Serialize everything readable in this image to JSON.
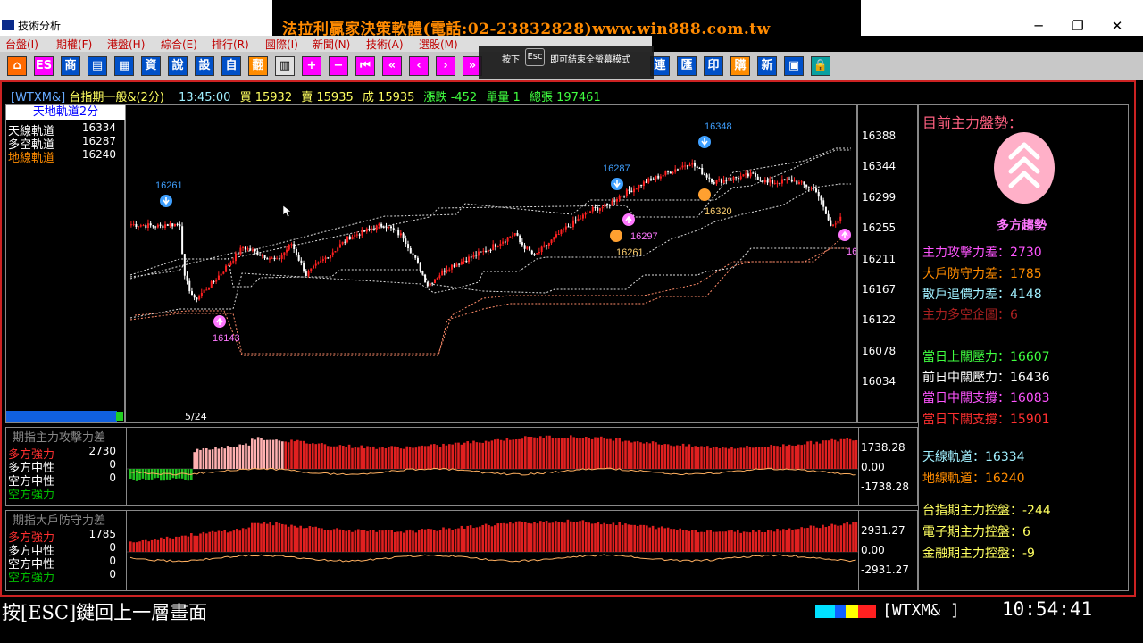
{
  "window": {
    "title": "技術分析",
    "banner": "法拉利贏家決策軟體(電話:02-23832828)www.win888.com.tw",
    "controls": {
      "minimize": "─",
      "restore": "❐",
      "close": "✕"
    }
  },
  "menu": [
    {
      "label": "台盤(I)"
    },
    {
      "label": "期權(F)"
    },
    {
      "label": "港盤(H)"
    },
    {
      "label": "綜合(E)"
    },
    {
      "label": "排行(R)"
    },
    {
      "label": "國際(I)"
    },
    {
      "label": "新聞(N)"
    },
    {
      "label": "技術(A)"
    },
    {
      "label": "選股(M)"
    }
  ],
  "toolbar": {
    "buttons": [
      {
        "name": "home-icon",
        "glyph": "⌂",
        "bg": "#ff6a00",
        "fg": "#fff"
      },
      {
        "name": "esc-icon",
        "glyph": "ES",
        "bg": "#ff00ff",
        "fg": "#fff"
      },
      {
        "name": "commodity-button",
        "glyph": "商",
        "bg": "#0050c8",
        "fg": "#fff"
      },
      {
        "name": "chart-button",
        "glyph": "▤",
        "bg": "#0050c8",
        "fg": "#fff"
      },
      {
        "name": "chart2-button",
        "glyph": "▦",
        "bg": "#0050c8",
        "fg": "#fff"
      },
      {
        "name": "info-button",
        "glyph": "資",
        "bg": "#0050c8",
        "fg": "#fff"
      },
      {
        "name": "said-button",
        "glyph": "說",
        "bg": "#0050c8",
        "fg": "#fff"
      },
      {
        "name": "set-button",
        "glyph": "設",
        "bg": "#0050c8",
        "fg": "#fff"
      },
      {
        "name": "self-button",
        "glyph": "自",
        "bg": "#0050c8",
        "fg": "#fff"
      },
      {
        "name": "report-button",
        "glyph": "翻",
        "bg": "#ff8c00",
        "fg": "#fff"
      },
      {
        "name": "list-button",
        "glyph": "▥",
        "bg": "#e0e0e0",
        "fg": "#000"
      },
      {
        "name": "plus-icon",
        "glyph": "+",
        "bg": "#ff00ff",
        "fg": "#fff"
      },
      {
        "name": "minus-icon",
        "glyph": "−",
        "bg": "#ff00ff",
        "fg": "#fff"
      },
      {
        "name": "first-icon",
        "glyph": "⏮",
        "bg": "#ff00ff",
        "fg": "#fff"
      },
      {
        "name": "fast-back-icon",
        "glyph": "«",
        "bg": "#ff00ff",
        "fg": "#fff"
      },
      {
        "name": "back-icon",
        "glyph": "‹",
        "bg": "#ff00ff",
        "fg": "#fff"
      },
      {
        "name": "forward-icon",
        "glyph": "›",
        "bg": "#ff00ff",
        "fg": "#fff"
      },
      {
        "name": "fast-forward-icon",
        "glyph": "»",
        "bg": "#ff00ff",
        "fg": "#fff"
      },
      {
        "name": "link-button",
        "glyph": "連",
        "bg": "#0050c8",
        "fg": "#fff"
      },
      {
        "name": "exchange-button",
        "glyph": "匯",
        "bg": "#0050c8",
        "fg": "#fff"
      },
      {
        "name": "print-button",
        "glyph": "印",
        "bg": "#0050c8",
        "fg": "#fff"
      },
      {
        "name": "buy-button",
        "glyph": "購",
        "bg": "#ff8c00",
        "fg": "#fff"
      },
      {
        "name": "new-button",
        "glyph": "新",
        "bg": "#0050c8",
        "fg": "#fff"
      },
      {
        "name": "window-icon",
        "glyph": "▣",
        "bg": "#0050c8",
        "fg": "#fff"
      },
      {
        "name": "lock-icon",
        "glyph": "🔒",
        "bg": "#0aa0a0",
        "fg": "#fff"
      }
    ],
    "esc_tip": {
      "prefix": "按下",
      "key": "Esc",
      "suffix": "即可結束全螢幕模式"
    }
  },
  "info_line": {
    "symbol": "[WTXM&]",
    "name": "台指期一般&(2分)",
    "time": "13:45:00",
    "bid_label": "買",
    "bid": "15932",
    "ask_label": "賣",
    "ask": "15935",
    "deal_label": "成",
    "deal": "15935",
    "change_label": "漲跌",
    "change": "-452",
    "vol_label": "單量",
    "vol": "1",
    "total_label": "總張",
    "total": "197461"
  },
  "main_legend": {
    "title": "天地軌道2分",
    "rows": [
      {
        "label": "天線軌道",
        "value": "16334",
        "color": "#ffffff"
      },
      {
        "label": "多空軌道",
        "value": "16287",
        "color": "#ffffff"
      },
      {
        "label": "地線軌道",
        "value": "16240",
        "color": "#ff8c00"
      }
    ],
    "date": "5/24"
  },
  "main_axis": [
    "16388",
    "16344",
    "16299",
    "16255",
    "16211",
    "16167",
    "16122",
    "16078",
    "16034"
  ],
  "markers": [
    {
      "label": "16261",
      "color": "#3fa0ff"
    },
    {
      "label": "16143",
      "color": "#ff77ff"
    },
    {
      "label": "16287",
      "color": "#3fa0ff"
    },
    {
      "label": "16297",
      "color": "#ff77ff"
    },
    {
      "label": "16261",
      "color": "#ffa030"
    },
    {
      "label": "16348",
      "color": "#3fa0ff"
    },
    {
      "label": "16320",
      "color": "#ffa030"
    },
    {
      "label": "16",
      "color": "#ff77ff"
    }
  ],
  "sub1": {
    "title": "期指主力攻擊力差",
    "rows": [
      {
        "label": "多方強力",
        "value": "2730",
        "color": "#ff3030"
      },
      {
        "label": "多方中性",
        "value": "0",
        "color": "#ffffff"
      },
      {
        "label": "空方中性",
        "value": "0",
        "color": "#ffffff"
      },
      {
        "label": "空方強力",
        "value": "",
        "color": "#00c000"
      }
    ],
    "axis": [
      "1738.28",
      "0.00",
      "-1738.28"
    ]
  },
  "sub2": {
    "title": "期指大戶防守力差",
    "rows": [
      {
        "label": "多方強力",
        "value": "1785",
        "color": "#ff3030"
      },
      {
        "label": "多方中性",
        "value": "0",
        "color": "#ffffff"
      },
      {
        "label": "空方中性",
        "value": "0",
        "color": "#ffffff"
      },
      {
        "label": "空方強力",
        "value": "0",
        "color": "#00c000"
      }
    ],
    "axis": [
      "2931.27",
      "0.00",
      "-2931.27"
    ]
  },
  "side": {
    "header": "目前主力盤勢：",
    "trend": "多方趨勢",
    "rows": [
      {
        "text": "主力攻擊力差：2730",
        "color": "#ff55ff"
      },
      {
        "text": "大戶防守力差：1785",
        "color": "#ff8c00"
      },
      {
        "text": "散戶追價力差：4148",
        "color": "#a0f0ff"
      },
      {
        "text": "主力多空企圖：6",
        "color": "#aa2020"
      },
      {
        "text": "當日上關壓力：16607",
        "color": "#40ff40"
      },
      {
        "text": "前日中關壓力：16436",
        "color": "#ffffff"
      },
      {
        "text": "當日中關支撐：16083",
        "color": "#ff55ff"
      },
      {
        "text": "當日下關支撐：15901",
        "color": "#ff3030"
      },
      {
        "text": "天線軌道：16334",
        "color": "#a0f0ff"
      },
      {
        "text": "地線軌道：16240",
        "color": "#ff8c00"
      },
      {
        "text": "台指期主力控盤：-244",
        "color": "#ffff60"
      },
      {
        "text": "電子期主力控盤：6",
        "color": "#ffff60"
      },
      {
        "text": "金融期主力控盤：-9",
        "color": "#ffff60"
      }
    ]
  },
  "status": {
    "hint": "按[ESC]鍵回上一層畫面",
    "symbol": "[WTXM&  ]",
    "clock": "10:54:41"
  }
}
